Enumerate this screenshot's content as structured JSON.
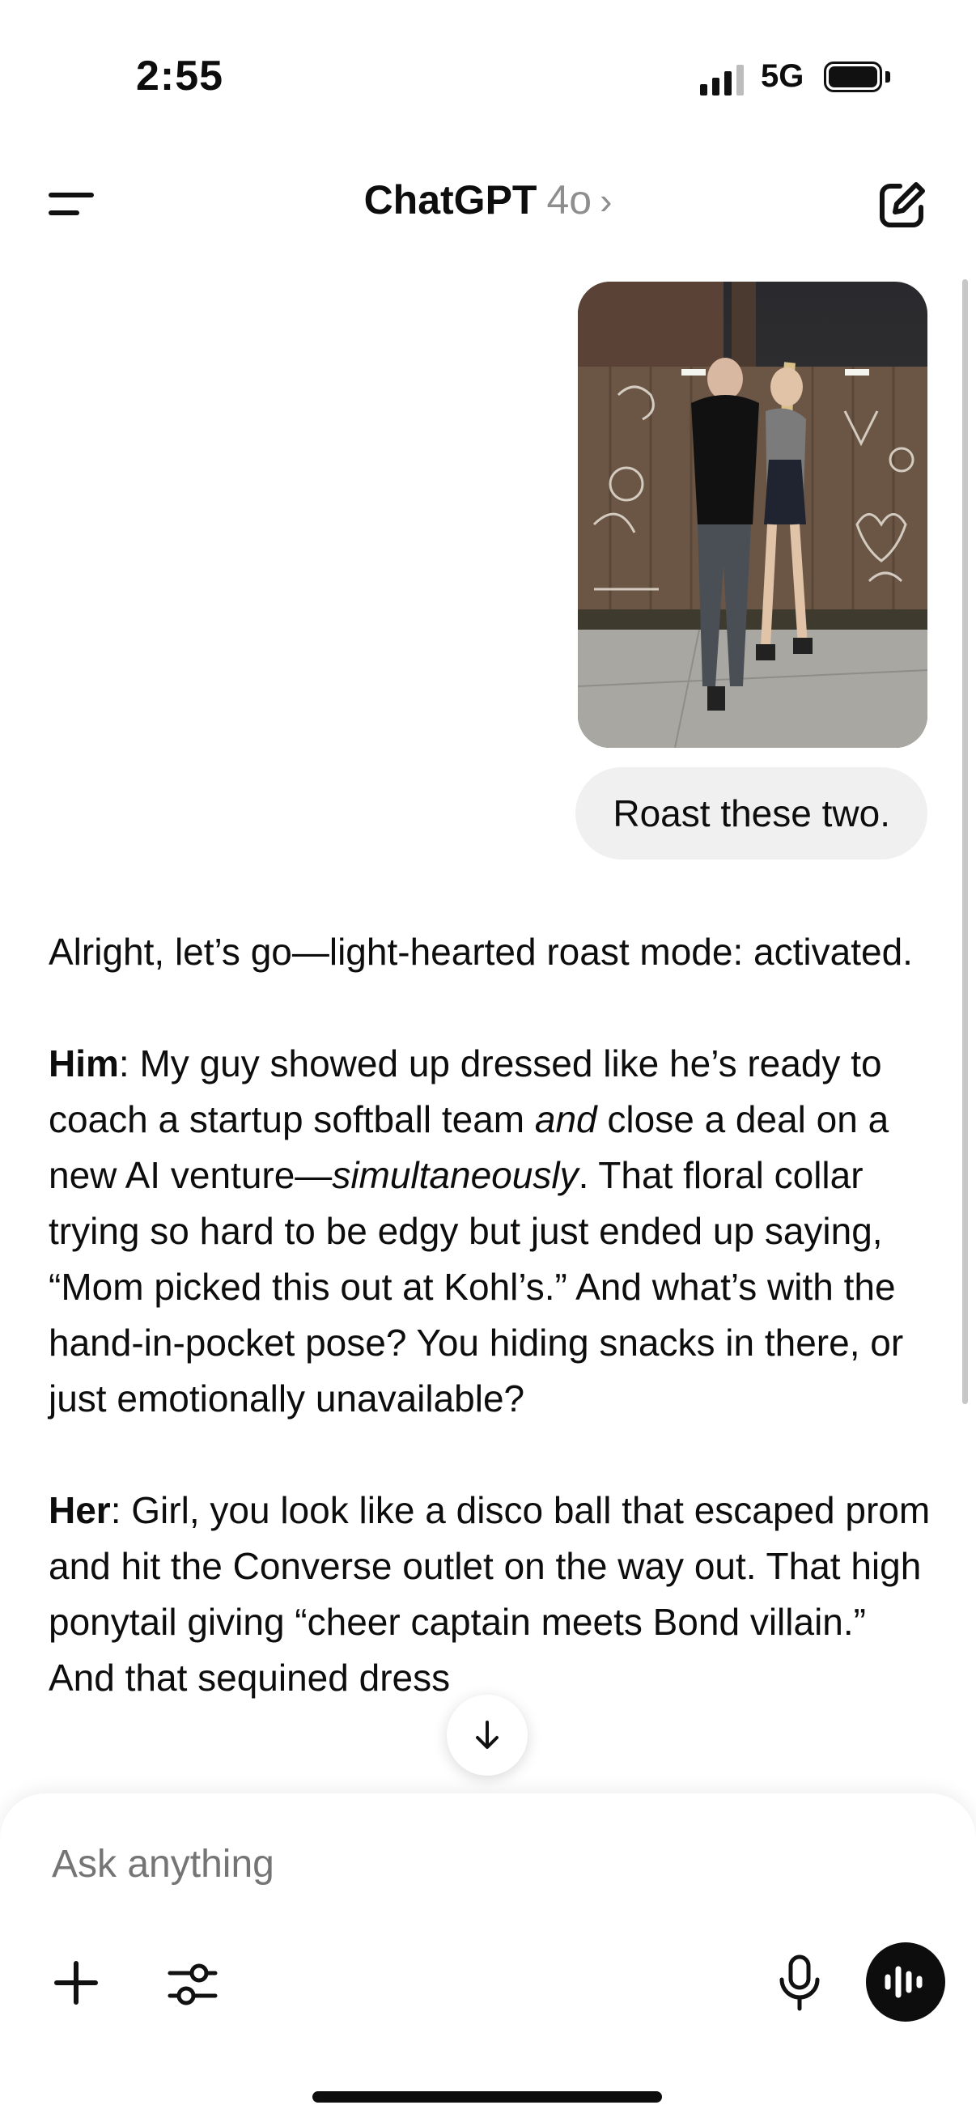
{
  "status_bar": {
    "time": "2:55",
    "network": "5G"
  },
  "header": {
    "title": "ChatGPT",
    "model": "4o",
    "chevron": "›",
    "menu_icon": "menu-icon",
    "new_chat_icon": "edit-icon"
  },
  "conversation": {
    "user_message": "Roast these two.",
    "assistant": {
      "intro": "Alright, let’s go—light-hearted roast mode: activated.",
      "him_label": "Him",
      "him_text_1": ": My guy showed up dressed like he’s ready to coach a startup softball team ",
      "him_italic_1": "and",
      "him_text_2": " close a deal on a new AI venture—",
      "him_italic_2": "simultaneously",
      "him_text_3": ". That floral collar trying so hard to be edgy but just ended up saying, “Mom picked this out at Kohl’s.” And what’s with the hand-in-pocket pose? You hiding snacks in there, or just emotionally unavailable?",
      "her_label": "Her",
      "her_text": ": Girl, you look like a disco ball that escaped prom and hit the Converse outlet on the way out. That high ponytail giving “cheer captain meets Bond villain.” And that sequined dress"
    }
  },
  "composer": {
    "placeholder": "Ask anything",
    "icons": [
      "plus-icon",
      "sliders-icon",
      "microphone-icon",
      "voice-mode-icon"
    ]
  },
  "colors": {
    "text": "#0d0d0d",
    "muted": "#8e8e8e",
    "bubble": "#f0f0f0",
    "accent": "#0d0d0d"
  }
}
